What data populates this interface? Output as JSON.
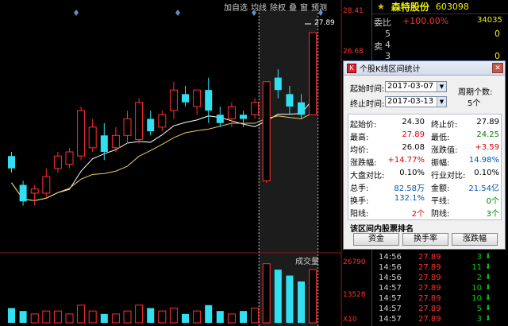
{
  "toolbar": [
    "加自选",
    "均线",
    "除权",
    "叠",
    "窗",
    "预测"
  ],
  "price_axis": {
    "top": "28.41",
    "mid": "26.68"
  },
  "vol_axis": {
    "top": "26790",
    "mid": "13528",
    "unit": "X10"
  },
  "vol_title": "成交量",
  "peak_price": "27.89",
  "stock": {
    "name": "森特股份",
    "code": "603098"
  },
  "quote": {
    "weibi_label": "委比",
    "weibi_pct": "+100.00%",
    "weibi_val": "34035",
    "sell_label": "卖",
    "levels": [
      {
        "n": "5",
        "v": "0"
      },
      {
        "n": "4",
        "v": ""
      },
      {
        "n": "3",
        "v": "0"
      }
    ]
  },
  "ticks": [
    {
      "t": "14:56",
      "p": "27.89",
      "v": "3",
      "a": "down"
    },
    {
      "t": "14:56",
      "p": "27.89",
      "v": "11",
      "a": "down"
    },
    {
      "t": "14:56",
      "p": "27.89",
      "v": "2",
      "a": "down"
    },
    {
      "t": "14:57",
      "p": "27.89",
      "v": "10",
      "a": "down"
    },
    {
      "t": "14:57",
      "p": "27.89",
      "v": "10",
      "a": "down"
    },
    {
      "t": "14:57",
      "p": "27.89",
      "v": "5",
      "a": "down"
    },
    {
      "t": "14:57",
      "p": "27.89",
      "v": "3",
      "a": "down"
    }
  ],
  "dialog": {
    "title": "个股K线区间统计",
    "start_label": "起始时间:",
    "start_date": "2017-03-07",
    "end_label": "终止时间:",
    "end_date": "2017-03-13",
    "period_label": "周期个数:",
    "period_val": "5个",
    "stats": [
      {
        "l1": "起始价:",
        "v1": "24.30",
        "c1": "",
        "l2": "终止价:",
        "v2": "27.89",
        "c2": ""
      },
      {
        "l1": "最高:",
        "v1": "27.89",
        "c1": "red",
        "l2": "最低:",
        "v2": "24.25",
        "c2": "green"
      },
      {
        "l1": "均价:",
        "v1": "26.08",
        "c1": "",
        "l2": "涨跌值:",
        "v2": "+3.59",
        "c2": "red"
      },
      {
        "l1": "涨跌幅:",
        "v1": "+14.77%",
        "c1": "red",
        "l2": "振幅:",
        "v2": "14.98%",
        "c2": "blue"
      },
      {
        "l1": "大盘对比:",
        "v1": "0.10%",
        "c1": "",
        "l2": "行业对比:",
        "v2": "0.10%",
        "c2": ""
      },
      {
        "l1": "总手:",
        "v1": "82.58万",
        "c1": "blue",
        "l2": "金额:",
        "v2": "21.54亿",
        "c2": "blue"
      },
      {
        "l1": "换手:",
        "v1": "132.1%",
        "c1": "blue",
        "l2": "平线:",
        "v2": "0个",
        "c2": "green"
      },
      {
        "l1": "阳线:",
        "v1": "2个",
        "c1": "red",
        "l2": "阴线:",
        "v2": "3个",
        "c2": "green"
      }
    ],
    "rank_title": "该区间内股票排名",
    "buttons": [
      "资金",
      "换手率",
      "涨跌幅"
    ]
  },
  "colors": {
    "up": "#ff3030",
    "down": "#30e0f0",
    "ma1": "#ffffff",
    "ma2": "#e8d060",
    "tick_green": "#00d000"
  },
  "kline": [
    {
      "o": 24.9,
      "c": 24.6,
      "h": 25.0,
      "l": 24.5
    },
    {
      "o": 24.2,
      "c": 23.8,
      "h": 24.3,
      "l": 23.7
    },
    {
      "o": 24.0,
      "c": 24.1,
      "h": 24.2,
      "l": 23.7
    },
    {
      "o": 24.0,
      "c": 24.4,
      "h": 24.6,
      "l": 23.9
    },
    {
      "o": 24.6,
      "c": 24.9,
      "h": 25.0,
      "l": 24.5
    },
    {
      "o": 24.7,
      "c": 25.0,
      "h": 25.1,
      "l": 24.6
    },
    {
      "o": 24.9,
      "c": 26.0,
      "h": 26.1,
      "l": 24.8
    },
    {
      "o": 25.1,
      "c": 25.6,
      "h": 25.8,
      "l": 25.0
    },
    {
      "o": 25.4,
      "c": 25.0,
      "h": 25.7,
      "l": 24.8
    },
    {
      "o": 25.1,
      "c": 25.4,
      "h": 25.6,
      "l": 25.0
    },
    {
      "o": 25.4,
      "c": 25.8,
      "h": 26.0,
      "l": 25.2
    },
    {
      "o": 25.3,
      "c": 26.2,
      "h": 26.3,
      "l": 25.2
    },
    {
      "o": 25.8,
      "c": 25.5,
      "h": 26.0,
      "l": 25.4
    },
    {
      "o": 25.6,
      "c": 25.9,
      "h": 26.0,
      "l": 25.5
    },
    {
      "o": 26.0,
      "c": 26.5,
      "h": 26.7,
      "l": 25.8
    },
    {
      "o": 26.4,
      "c": 26.2,
      "h": 26.6,
      "l": 26.1
    },
    {
      "o": 26.1,
      "c": 26.5,
      "h": 26.5,
      "l": 25.9
    },
    {
      "o": 26.5,
      "c": 26.0,
      "h": 26.8,
      "l": 25.7
    },
    {
      "o": 25.9,
      "c": 25.7,
      "h": 26.1,
      "l": 25.6
    },
    {
      "o": 25.8,
      "c": 26.1,
      "h": 26.2,
      "l": 25.6
    },
    {
      "o": 25.9,
      "c": 25.8,
      "h": 26.0,
      "l": 25.6
    },
    {
      "o": 25.9,
      "c": 26.2,
      "h": 26.3,
      "l": 25.8
    },
    {
      "o": 24.3,
      "c": 26.7,
      "h": 26.7,
      "l": 24.25
    },
    {
      "o": 26.8,
      "c": 26.5,
      "h": 27.0,
      "l": 26.3
    },
    {
      "o": 26.4,
      "c": 26.1,
      "h": 26.6,
      "l": 25.9
    },
    {
      "o": 26.2,
      "c": 25.9,
      "h": 26.4,
      "l": 25.8
    },
    {
      "o": 25.9,
      "c": 27.89,
      "h": 27.89,
      "l": 25.9
    }
  ],
  "volumes": [
    5,
    4,
    3,
    4,
    4,
    3,
    6,
    4,
    3,
    3,
    4,
    6,
    5,
    4,
    5,
    3,
    4,
    6,
    4,
    3,
    4,
    5,
    20,
    18,
    16,
    14,
    18
  ]
}
